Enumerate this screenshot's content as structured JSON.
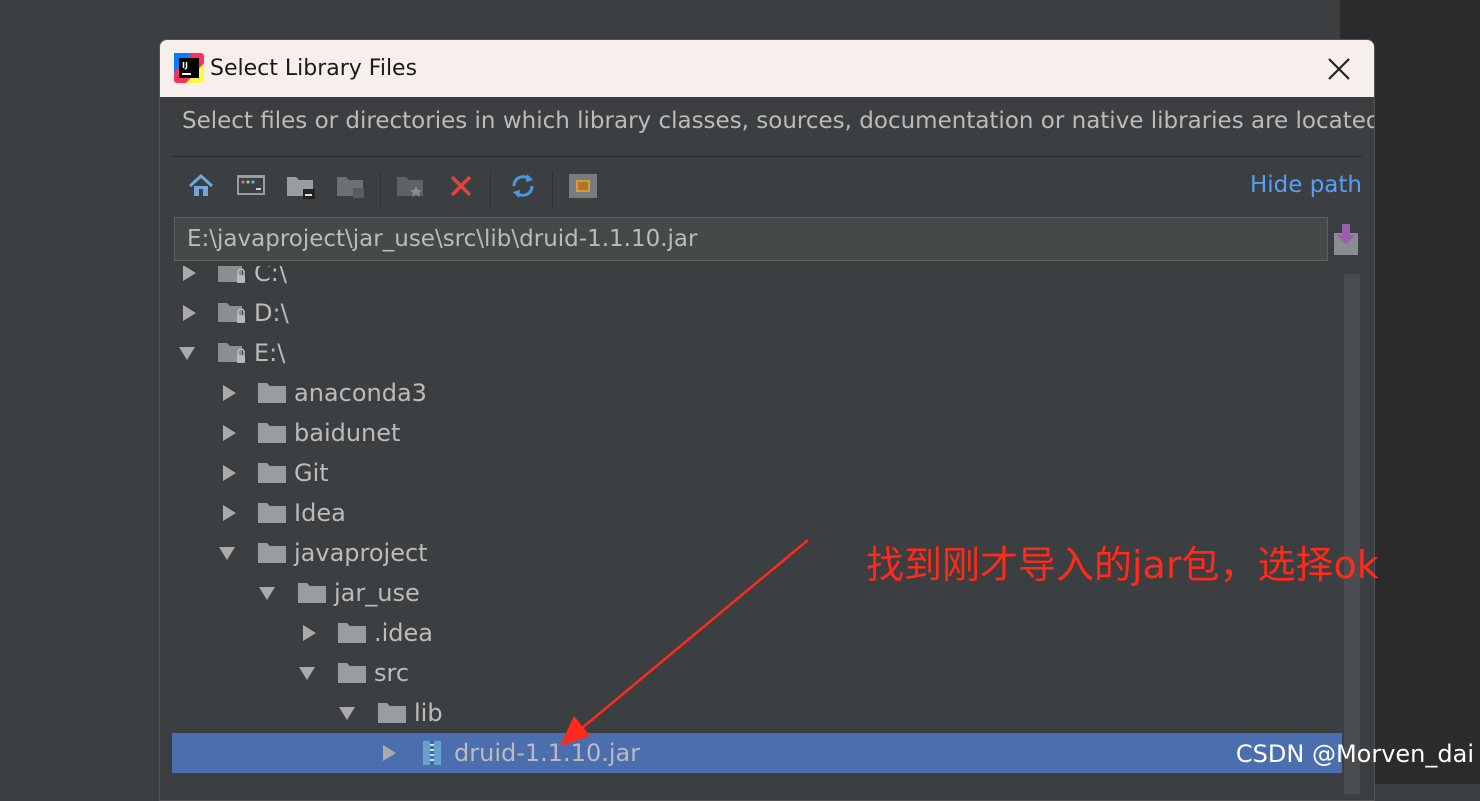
{
  "window": {
    "title": "Select Library Files",
    "description": "Select files or directories in which library classes, sources, documentation or native libraries are located"
  },
  "toolbar": {
    "hide_path_label": "Hide path",
    "icons": [
      "home-icon",
      "desktop-icon",
      "project-folder-icon",
      "module-folder-icon",
      "new-folder-icon",
      "delete-icon",
      "refresh-icon",
      "show-hidden-icon"
    ]
  },
  "path_field": {
    "value": "E:\\javaproject\\jar_use\\src\\lib\\druid-1.1.10.jar"
  },
  "tree": {
    "rows": [
      {
        "label": "C:\\",
        "expanded": false,
        "kind": "drive"
      },
      {
        "label": "D:\\",
        "expanded": false,
        "kind": "drive"
      },
      {
        "label": "E:\\",
        "expanded": true,
        "kind": "drive"
      },
      {
        "label": "anaconda3",
        "expanded": false,
        "kind": "folder"
      },
      {
        "label": "baidunet",
        "expanded": false,
        "kind": "folder"
      },
      {
        "label": "Git",
        "expanded": false,
        "kind": "folder"
      },
      {
        "label": "Idea",
        "expanded": false,
        "kind": "folder"
      },
      {
        "label": "javaproject",
        "expanded": true,
        "kind": "folder"
      },
      {
        "label": "jar_use",
        "expanded": true,
        "kind": "folder"
      },
      {
        "label": ".idea",
        "expanded": false,
        "kind": "folder"
      },
      {
        "label": "src",
        "expanded": true,
        "kind": "folder"
      },
      {
        "label": "lib",
        "expanded": true,
        "kind": "folder"
      },
      {
        "label": "druid-1.1.10.jar",
        "expanded": false,
        "kind": "jar",
        "selected": true
      }
    ]
  },
  "annotation": {
    "text": "找到刚才导入的jar包，选择ok",
    "color": "#ff2a1a"
  },
  "watermark": "CSDN @Morven_dai",
  "colors": {
    "selection": "#4b6eaf",
    "link": "#589df6",
    "background": "#3c3f41"
  }
}
